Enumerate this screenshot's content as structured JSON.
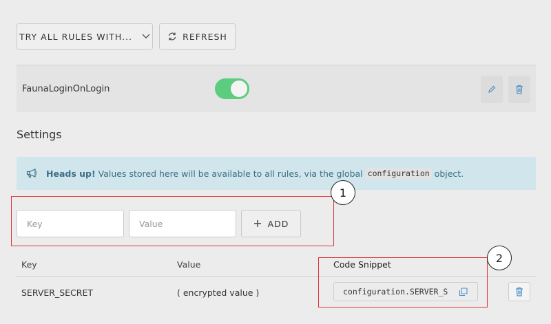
{
  "toolbar": {
    "try_rules_label": "TRY ALL RULES WITH...",
    "refresh_label": "REFRESH"
  },
  "rule": {
    "name": "FaunaLoginOnLogin",
    "enabled": true
  },
  "settings": {
    "title": "Settings",
    "notice_bold": "Heads up!",
    "notice_text": "Values stored here will be available to all rules, via the global",
    "notice_code": "configuration",
    "notice_tail": "object."
  },
  "form": {
    "key_placeholder": "Key",
    "value_placeholder": "Value",
    "add_label": "ADD"
  },
  "table": {
    "headers": [
      "Key",
      "Value",
      "Code Snippet"
    ],
    "rows": [
      {
        "key": "SERVER_SECRET",
        "value": "( encrypted value )",
        "snippet": "configuration.SERVER_S"
      }
    ]
  },
  "annotations": [
    "1",
    "2"
  ],
  "colors": {
    "toggle_on": "#5ccc7e",
    "notice_bg": "#d0e6ec",
    "annotation_red": "#e0323a",
    "icon_blue": "#4a8fc7"
  }
}
